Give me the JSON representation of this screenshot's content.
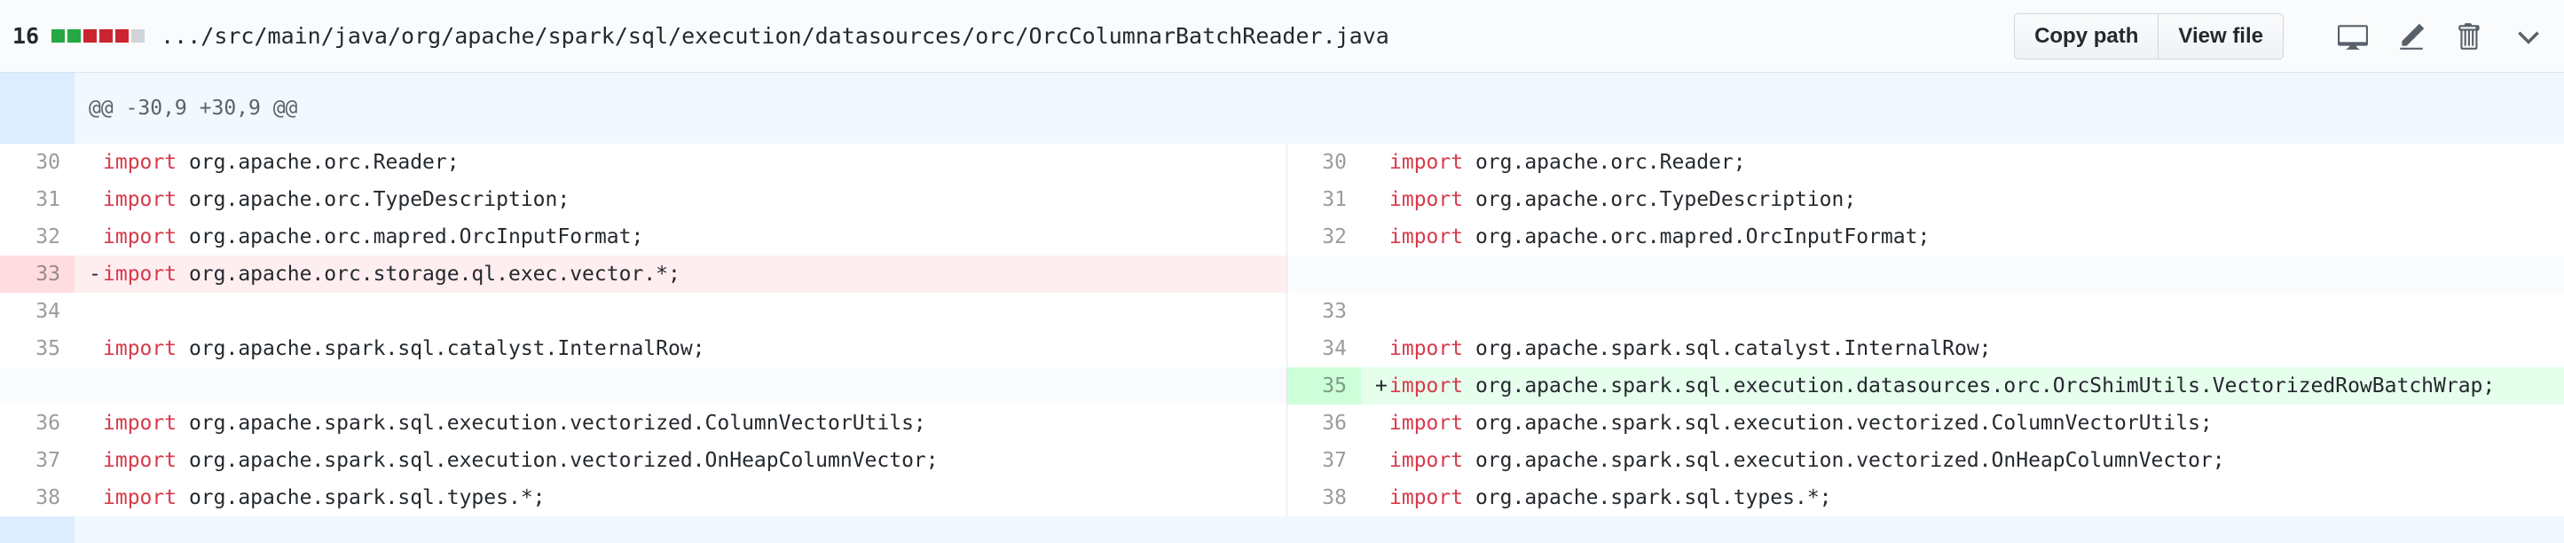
{
  "file_header": {
    "diffstat_count": "16",
    "diffstat_blocks": [
      "#28a745",
      "#28a745",
      "#cb2431",
      "#cb2431",
      "#cb2431",
      "#d1d5da"
    ],
    "file_path": ".../src/main/java/org/apache/spark/sql/execution/datasources/orc/OrcColumnarBatchReader.java",
    "copy_path_label": "Copy path",
    "view_file_label": "View file",
    "icons": [
      "desktop-icon",
      "pencil-icon",
      "trash-icon",
      "chevron-down-icon"
    ]
  },
  "hunk": {
    "header": "@@ -30,9 +30,9 @@",
    "expand_icon": "unfold-icon"
  },
  "colors": {
    "keyword": "#d73a49",
    "deletion_bg": "#ffeef0",
    "addition_bg": "#e6ffed",
    "hunk_bg": "#f1f8ff"
  },
  "rows": [
    {
      "left_num": "30",
      "left_marker": "",
      "left_kw": "import",
      "left_rest": " org.apache.orc.Reader;",
      "right_num": "30",
      "right_marker": "",
      "right_kw": "import",
      "right_rest": " org.apache.orc.Reader;"
    },
    {
      "left_num": "31",
      "left_marker": "",
      "left_kw": "import",
      "left_rest": " org.apache.orc.TypeDescription;",
      "right_num": "31",
      "right_marker": "",
      "right_kw": "import",
      "right_rest": " org.apache.orc.TypeDescription;"
    },
    {
      "left_num": "32",
      "left_marker": "",
      "left_kw": "import",
      "left_rest": " org.apache.orc.mapred.OrcInputFormat;",
      "right_num": "32",
      "right_marker": "",
      "right_kw": "import",
      "right_rest": " org.apache.orc.mapred.OrcInputFormat;"
    },
    {
      "left_num": "33",
      "left_marker": "-",
      "left_kw": "import",
      "left_rest": " org.apache.orc.storage.ql.exec.vector.*;",
      "right_num": "",
      "right_marker": "",
      "right_kw": "",
      "right_rest": ""
    },
    {
      "left_num": "34",
      "left_marker": "",
      "left_kw": "",
      "left_rest": "",
      "right_num": "33",
      "right_marker": "",
      "right_kw": "",
      "right_rest": ""
    },
    {
      "left_num": "35",
      "left_marker": "",
      "left_kw": "import",
      "left_rest": " org.apache.spark.sql.catalyst.InternalRow;",
      "right_num": "34",
      "right_marker": "",
      "right_kw": "import",
      "right_rest": " org.apache.spark.sql.catalyst.InternalRow;"
    },
    {
      "left_num": "",
      "left_marker": "",
      "left_kw": "",
      "left_rest": "",
      "right_num": "35",
      "right_marker": "+",
      "right_kw": "import",
      "right_rest": " org.apache.spark.sql.execution.datasources.orc.OrcShimUtils.VectorizedRowBatchWrap;"
    },
    {
      "left_num": "36",
      "left_marker": "",
      "left_kw": "import",
      "left_rest": " org.apache.spark.sql.execution.vectorized.ColumnVectorUtils;",
      "right_num": "36",
      "right_marker": "",
      "right_kw": "import",
      "right_rest": " org.apache.spark.sql.execution.vectorized.ColumnVectorUtils;"
    },
    {
      "left_num": "37",
      "left_marker": "",
      "left_kw": "import",
      "left_rest": " org.apache.spark.sql.execution.vectorized.OnHeapColumnVector;",
      "right_num": "37",
      "right_marker": "",
      "right_kw": "import",
      "right_rest": " org.apache.spark.sql.execution.vectorized.OnHeapColumnVector;"
    },
    {
      "left_num": "38",
      "left_marker": "",
      "left_kw": "import",
      "left_rest": " org.apache.spark.sql.types.*;",
      "right_num": "38",
      "right_marker": "",
      "right_kw": "import",
      "right_rest": " org.apache.spark.sql.types.*;"
    }
  ]
}
